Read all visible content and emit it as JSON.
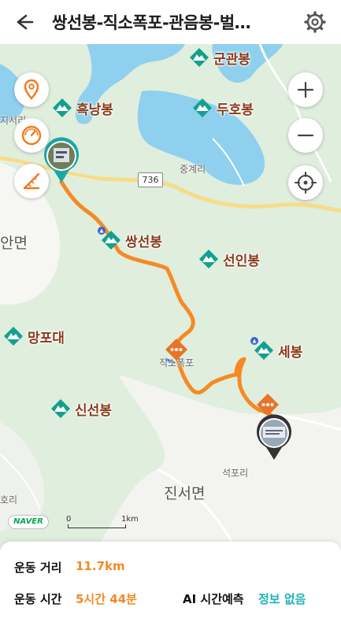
{
  "header": {
    "title": "쌍선봉-직소폭포-관음봉-벌…",
    "back_icon": "arrow-left-icon",
    "settings_icon": "gear-icon"
  },
  "map": {
    "peaks": [
      {
        "key": "gungwanbong",
        "name": "군관봉"
      },
      {
        "key": "heuknangbong",
        "name": "흑낭봉"
      },
      {
        "key": "duhobong",
        "name": "두호봉"
      },
      {
        "key": "ssangseonbong",
        "name": "쌍선봉"
      },
      {
        "key": "seoninbong",
        "name": "선인봉"
      },
      {
        "key": "mangpodae",
        "name": "망포대"
      },
      {
        "key": "sebong",
        "name": "세봉"
      },
      {
        "key": "sinseonbong",
        "name": "신선봉"
      }
    ],
    "places": {
      "jungyeri": "중계리",
      "jiseori": "지서리",
      "seokpori": "석포리",
      "hori": "호리",
      "jikso": "직소폭포"
    },
    "areas": {
      "jinseo": "진서면",
      "left": "안면"
    },
    "road_number": "736",
    "naver_logo": "NAVER",
    "scale": {
      "zero": "0",
      "one": "1km"
    },
    "controls": {
      "location": "location-pin-icon",
      "speed": "speedometer-icon",
      "distance": "ruler-icon",
      "zoom_in": "plus-icon",
      "zoom_out": "minus-icon",
      "my_location": "crosshair-icon"
    },
    "colors": {
      "route": "#f58a25",
      "water": "#8ed0ee",
      "land": "#dfeedd",
      "peak_text": "#8a3a1a",
      "peak_icon": "#12a08f"
    }
  },
  "stats": {
    "distance_label": "운동 거리",
    "distance_value": "11.7km",
    "time_label": "운동 시간",
    "time_value": "5시간 44분",
    "ai_label": "AI 시간예측",
    "ai_value": "정보 없음"
  }
}
